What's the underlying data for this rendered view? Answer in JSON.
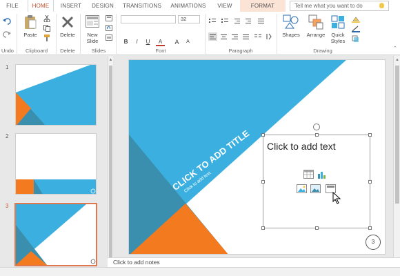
{
  "tabs": {
    "file": "FILE",
    "home": "HOME",
    "insert": "INSERT",
    "design": "DESIGN",
    "transitions": "TRANSITIONS",
    "animations": "ANIMATIONS",
    "view": "VIEW",
    "format": "FORMAT"
  },
  "tell_me": {
    "placeholder": "Tell me what you want to do"
  },
  "ribbon": {
    "groups": {
      "undo": "Undo",
      "clipboard": "Clipboard",
      "delete": "Delete",
      "slides": "Slides",
      "font": "Font",
      "paragraph": "Paragraph",
      "drawing": "Drawing"
    },
    "buttons": {
      "paste": "Paste",
      "delete": "Delete",
      "new_slide_1": "New",
      "new_slide_2": "Slide",
      "shapes": "Shapes",
      "arrange": "Arrange",
      "quick_styles_1": "Quick",
      "quick_styles_2": "Styles"
    },
    "font_size": "32",
    "font_name": "",
    "format_buttons": {
      "bold": "B",
      "italic": "I",
      "underline": "U",
      "font_color": "A",
      "grow": "A",
      "shrink": "A"
    }
  },
  "thumbnails": [
    {
      "number": "1"
    },
    {
      "number": "2"
    },
    {
      "number": "3"
    }
  ],
  "slide": {
    "title": "CLICK TO ADD TITLE",
    "subtitle": "Click to add text",
    "placeholder_title": "Click to add text",
    "slide_number": "3"
  },
  "notes": {
    "text": "Click to add notes"
  },
  "colors": {
    "accent_blue": "#3bb0e0",
    "dark_teal": "#3a8fae",
    "orange": "#f47a20",
    "tab_active": "#c5502d",
    "format_tab_bg": "#fbe3d6"
  },
  "icons": [
    "undo-icon",
    "redo-icon",
    "paste-icon",
    "cut-icon",
    "copy-icon",
    "format-painter-icon",
    "delete-icon",
    "new-slide-icon",
    "shapes-icon",
    "arrange-icon",
    "quick-styles-icon",
    "table-icon",
    "chart-icon",
    "picture-icon",
    "online-picture-icon",
    "video-icon",
    "rotate-icon",
    "bulb-icon"
  ]
}
